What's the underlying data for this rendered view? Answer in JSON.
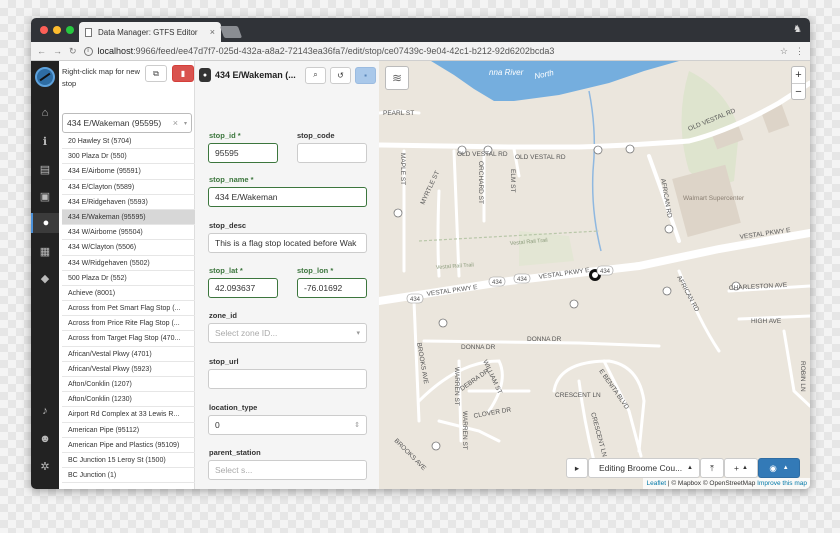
{
  "browser": {
    "tab_title": "Data Manager: GTFS Editor",
    "tab_close": "×",
    "url_host": "localhost",
    "url_rest": ":9966/feed/ee47d7f7-025d-432a-a8a2-72143ea36fa7/edit/stop/ce07439c-9e04-42c1-b212-92d6202bcda3"
  },
  "icons": {
    "back": "←",
    "forward": "→",
    "reload": "↻",
    "star": "☆",
    "menu": "⋮",
    "nav_home": "⌂",
    "nav_info": "ℹ",
    "nav_calendar_grid": "▤",
    "nav_bus": "▣",
    "nav_pin": "●",
    "nav_calendar": "▦",
    "nav_tag": "◆",
    "nav_bell": "♪",
    "nav_user": "☻",
    "nav_gear": "✲",
    "copy": "⧉",
    "trash": "▮",
    "search": "⌕",
    "undo": "↺",
    "save": "▪",
    "layers": "≋",
    "play": "▸",
    "upload": "⤒",
    "camera": "◉",
    "caret": "▾"
  },
  "list": {
    "hint": "Right-click map for new stop",
    "selected_value": "434 E/Wakeman (95595)",
    "clear": "×",
    "items": [
      "20 Hawley St (5704)",
      "300 Plaza Dr (550)",
      "434 E/Airborne (95591)",
      "434 E/Clayton (5589)",
      "434 E/Ridgehaven (5593)",
      "434 E/Wakeman (95595)",
      "434 W/Airborne (95504)",
      "434 W/Clayton (5506)",
      "434 W/Ridgehaven (5502)",
      "500 Plaza Dr (552)",
      "Achieve (8001)",
      "Across from Pet Smart Flag Stop (...",
      "Across from Price Rite Flag Stop (...",
      "Across from Target Flag Stop (470...",
      "African/Vestal Pkwy (4701)",
      "African/Vestal Pkwy (5923)",
      "Afton/Conklin (1207)",
      "Afton/Conklin (1230)",
      "Airport Rd Complex at 33 Lewis R...",
      "American Pipe (95112)",
      "American Pipe and Plastics (95109)",
      "BC Junction 15 Leroy St (1500)",
      "BC Junction (1)"
    ],
    "selected_index": 5
  },
  "form": {
    "title": "434 E/Wakeman (...",
    "stop_id_label": "stop_id *",
    "stop_id": "95595",
    "stop_code_label": "stop_code",
    "stop_code": "",
    "stop_name_label": "stop_name *",
    "stop_name": "434 E/Wakeman",
    "stop_desc_label": "stop_desc",
    "stop_desc": "This is a flag stop located before Wak",
    "stop_lat_label": "stop_lat *",
    "stop_lat": "42.093637",
    "stop_lon_label": "stop_lon *",
    "stop_lon": "-76.01692",
    "zone_id_label": "zone_id",
    "zone_id_placeholder": "Select zone ID...",
    "stop_url_label": "stop_url",
    "stop_url": "",
    "location_type_label": "location_type",
    "location_type": "0",
    "parent_station_label": "parent_station",
    "parent_station_placeholder": "Select s..."
  },
  "map": {
    "zoom_in": "+",
    "zoom_out": "−",
    "editing_label": "Editing Broome Cou...",
    "add_label": "+",
    "attribution_leaflet": "Leaflet",
    "attribution_rest": " | © Mapbox © OpenStreetMap ",
    "attribution_improve": "Improve this map",
    "labels": {
      "river": "nna River",
      "north": "North",
      "pearl": "PEARL ST",
      "old_vestal_1": "OLD VESTAL RD",
      "old_vestal_2": "OLD VESTAL RD",
      "old_vestal_3": "OLD VESTAL RD",
      "maple": "MAPLE ST",
      "myrtle": "MYRTLE ST",
      "orchard": "ORCHARD ST",
      "elm": "ELM ST",
      "african_1": "AFRICAN RD",
      "african_2": "AFRICAN RD",
      "walmart": "Walmart Supercenter",
      "trail_1": "Vestal Rail Trail",
      "trail_2": "Vestal Rail Trail",
      "vestal_1": "VESTAL PKWY E",
      "vestal_2": "VESTAL PKWY E",
      "vestal_3": "VESTAL PKWY E",
      "charleston": "CHARLESTON AVE",
      "high": "HIGH AVE",
      "donna_1": "DONNA DR",
      "donna_2": "DONNA DR",
      "brooks_1": "BROOKS AVE",
      "brooks_2": "BROOKS AVE",
      "warren_1": "WARREN ST",
      "warren_2": "WARREN ST",
      "william": "WILLIAM ST",
      "debra": "DEBRA DR",
      "clover": "CLOVER DR",
      "crescent_1": "CRESCENT LN",
      "crescent_2": "CRESCENT LN",
      "benita": "E BENITA BLVD",
      "robin": "ROBIN LN",
      "shield_434": "434"
    }
  }
}
